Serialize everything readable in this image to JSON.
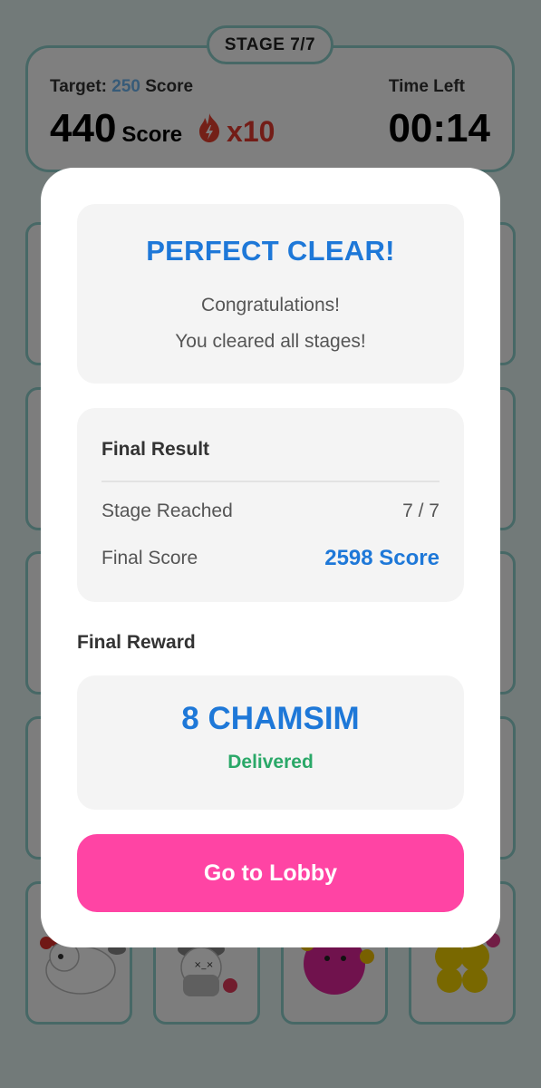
{
  "hud": {
    "stage_label": "STAGE 7/7",
    "target_label": "Target:",
    "target_value": "250",
    "target_unit": "Score",
    "score_value": "440",
    "score_unit": "Score",
    "multiplier": "x10",
    "time_left_label": "Time Left",
    "time_left_value": "00:14"
  },
  "modal": {
    "title": "PERFECT CLEAR!",
    "message_line1": "Congratulations!",
    "message_line2": "You cleared all stages!",
    "result": {
      "header": "Final Result",
      "stage_label": "Stage Reached",
      "stage_value": "7 / 7",
      "score_label": "Final Score",
      "score_value": "2598 Score"
    },
    "reward": {
      "label": "Final Reward",
      "amount": "8 CHAMSIM",
      "status": "Delivered"
    },
    "button_label": "Go to Lobby"
  },
  "colors": {
    "accent_blue": "#1e78d8",
    "success_green": "#2aa868",
    "button_pink": "#ff44a4",
    "multiplier_red": "#e63b2e",
    "card_border": "#8fd1cc"
  },
  "icons": [
    "flame-icon"
  ]
}
